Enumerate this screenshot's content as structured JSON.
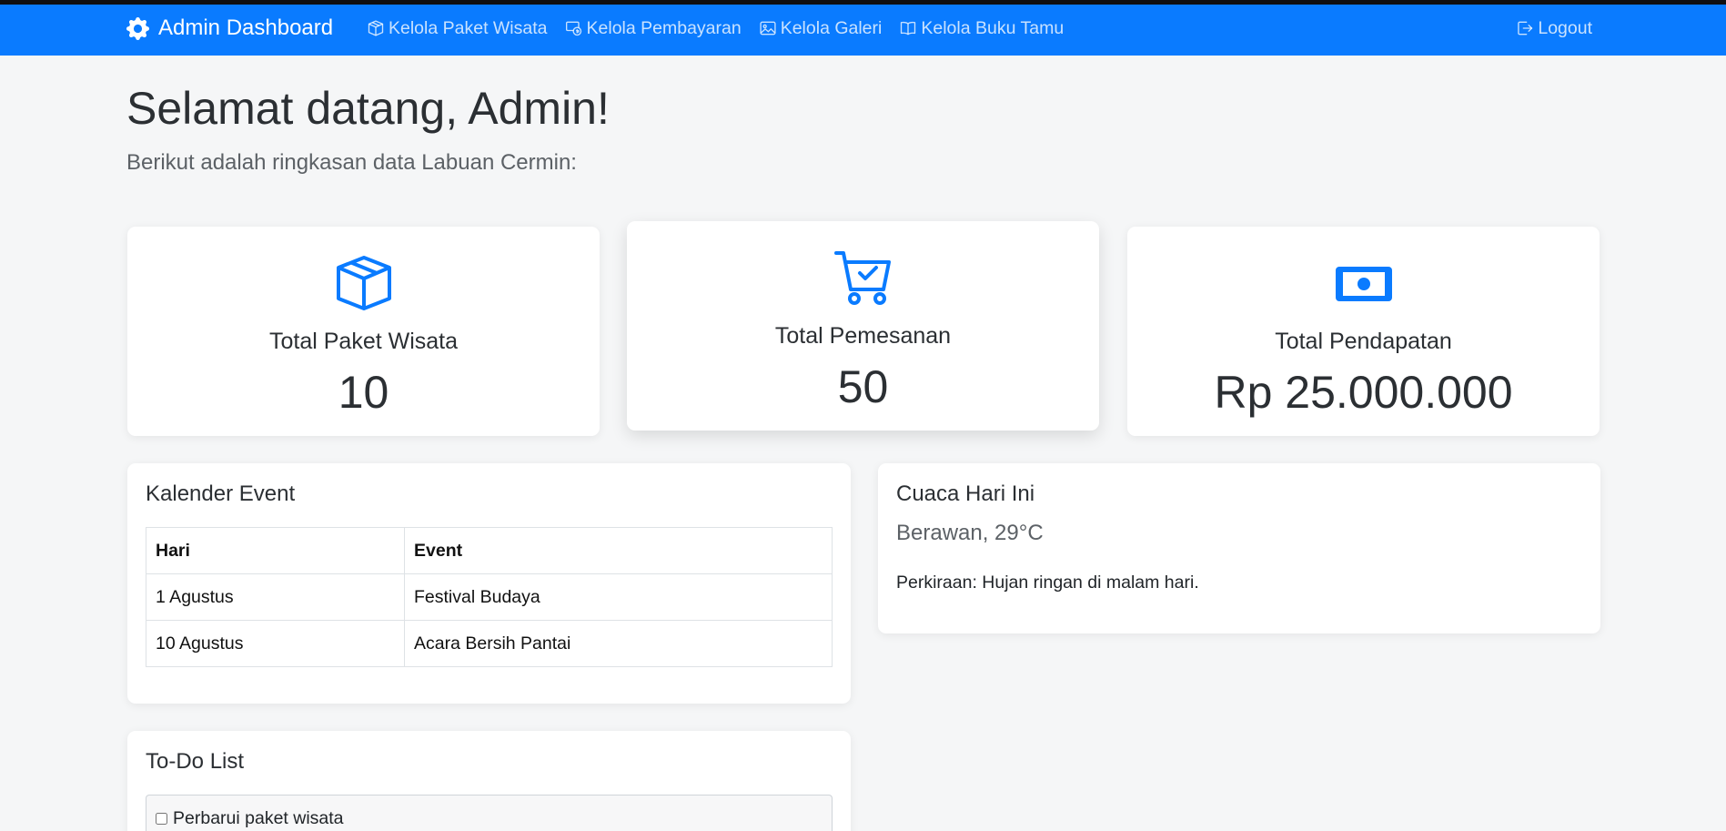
{
  "navbar": {
    "brand": "Admin Dashboard",
    "links": [
      {
        "label": "Kelola Paket Wisata",
        "icon": "box-icon"
      },
      {
        "label": "Kelola Pembayaran",
        "icon": "cash-coin-icon"
      },
      {
        "label": "Kelola Galeri",
        "icon": "image-icon"
      },
      {
        "label": "Kelola Buku Tamu",
        "icon": "book-icon"
      }
    ],
    "logout": "Logout",
    "color": "#0a7bff"
  },
  "header": {
    "title": "Selamat datang, Admin!",
    "subtitle": "Berikut adalah ringkasan data Labuan Cermin:"
  },
  "stats": [
    {
      "label": "Total Paket Wisata",
      "value": "10",
      "icon": "box-icon"
    },
    {
      "label": "Total Pemesanan",
      "value": "50",
      "icon": "cart-check-icon"
    },
    {
      "label": "Total Pendapatan",
      "value": "Rp 25.000.000",
      "icon": "cash-icon"
    }
  ],
  "calendar": {
    "title": "Kalender Event",
    "columns": [
      "Hari",
      "Event"
    ],
    "rows": [
      [
        "1 Agustus",
        "Festival Budaya"
      ],
      [
        "10 Agustus",
        "Acara Bersih Pantai"
      ]
    ]
  },
  "weather": {
    "title": "Cuaca Hari Ini",
    "current": "Berawan, 29°C",
    "forecast": "Perkiraan: Hujan ringan di malam hari."
  },
  "todo": {
    "title": "To-Do List",
    "items": [
      {
        "label": "Perbarui paket wisata",
        "checked": false
      }
    ]
  }
}
